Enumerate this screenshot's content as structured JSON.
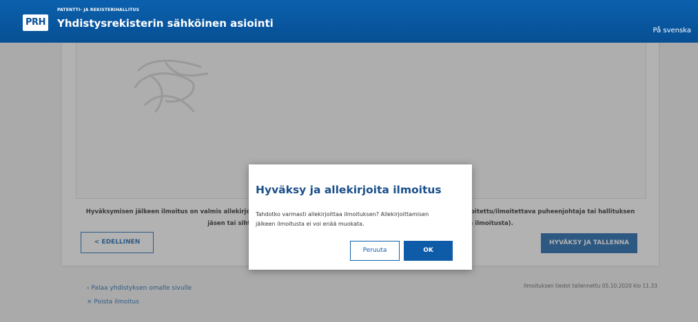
{
  "header": {
    "logo_text": "PRH",
    "agency": "PATENTTI- JA REKISTERIHALLITUS",
    "service_title": "Yhdistysrekisterin sähköinen asiointi",
    "language_link": "På svenska"
  },
  "main": {
    "notice_line1": "Hyväksymisen jälkeen ilmoitus on valmis allekirjoitettavaksi. Voit allekirjoittaa ilmoituksen, jos olet yhdistyksen ilmoitettu/ilmoitettava puheenjohtaja tai hallituksen",
    "notice_line2": "jäsen tai sihteeri (lisää allekirjoitusoikeuta hallituksen jäsentä allekirjoittamaan ilmoitusta).",
    "back_button": "< EDELLINEN",
    "approve_save_button": "HYVÄKSY JA TALLENNA"
  },
  "footer_links": {
    "back_to_association": "Palaa yhdistyksen omalle sivulle",
    "delete_notice": "Poista ilmoitus",
    "saved_info": "Ilmoituksen tiedot tallennettu 05.10.2020 klo 11.33"
  },
  "modal": {
    "title": "Hyväksy ja allekirjoita ilmoitus",
    "body": "Tahdotko varmasti allekirjoittaa ilmoituksen? Allekirjoittamisen jälkeen ilmoitusta ei voi enää muokata.",
    "cancel_label": "Peruuta",
    "ok_label": "OK"
  },
  "colors": {
    "brand_blue": "#0b5aa7",
    "link_blue": "#1060aa",
    "overlay": "rgba(85,85,85,0.45)"
  },
  "icons": {
    "back_link_icon": "chevron-left-icon",
    "delete_icon": "close-icon"
  }
}
